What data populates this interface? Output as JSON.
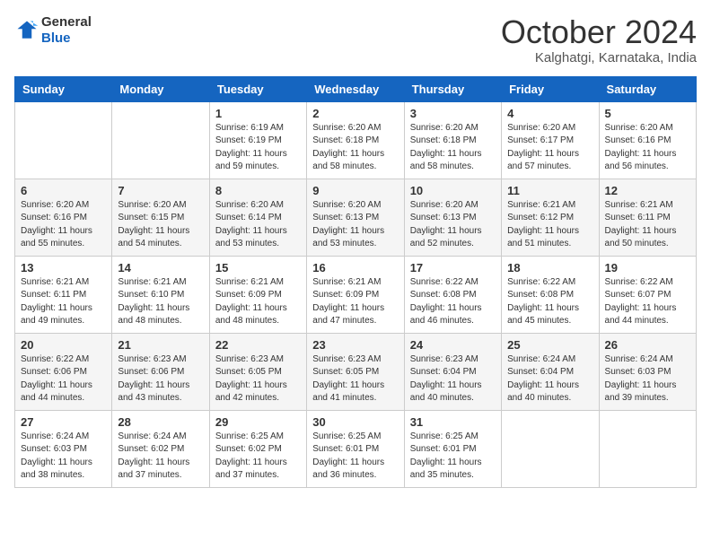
{
  "logo": {
    "general": "General",
    "blue": "Blue"
  },
  "title": "October 2024",
  "subtitle": "Kalghatgi, Karnataka, India",
  "days": [
    "Sunday",
    "Monday",
    "Tuesday",
    "Wednesday",
    "Thursday",
    "Friday",
    "Saturday"
  ],
  "weeks": [
    [
      {
        "day": "",
        "sunrise": "",
        "sunset": "",
        "daylight": ""
      },
      {
        "day": "",
        "sunrise": "",
        "sunset": "",
        "daylight": ""
      },
      {
        "day": "1",
        "sunrise": "Sunrise: 6:19 AM",
        "sunset": "Sunset: 6:19 PM",
        "daylight": "Daylight: 11 hours and 59 minutes."
      },
      {
        "day": "2",
        "sunrise": "Sunrise: 6:20 AM",
        "sunset": "Sunset: 6:18 PM",
        "daylight": "Daylight: 11 hours and 58 minutes."
      },
      {
        "day": "3",
        "sunrise": "Sunrise: 6:20 AM",
        "sunset": "Sunset: 6:18 PM",
        "daylight": "Daylight: 11 hours and 58 minutes."
      },
      {
        "day": "4",
        "sunrise": "Sunrise: 6:20 AM",
        "sunset": "Sunset: 6:17 PM",
        "daylight": "Daylight: 11 hours and 57 minutes."
      },
      {
        "day": "5",
        "sunrise": "Sunrise: 6:20 AM",
        "sunset": "Sunset: 6:16 PM",
        "daylight": "Daylight: 11 hours and 56 minutes."
      }
    ],
    [
      {
        "day": "6",
        "sunrise": "Sunrise: 6:20 AM",
        "sunset": "Sunset: 6:16 PM",
        "daylight": "Daylight: 11 hours and 55 minutes."
      },
      {
        "day": "7",
        "sunrise": "Sunrise: 6:20 AM",
        "sunset": "Sunset: 6:15 PM",
        "daylight": "Daylight: 11 hours and 54 minutes."
      },
      {
        "day": "8",
        "sunrise": "Sunrise: 6:20 AM",
        "sunset": "Sunset: 6:14 PM",
        "daylight": "Daylight: 11 hours and 53 minutes."
      },
      {
        "day": "9",
        "sunrise": "Sunrise: 6:20 AM",
        "sunset": "Sunset: 6:13 PM",
        "daylight": "Daylight: 11 hours and 53 minutes."
      },
      {
        "day": "10",
        "sunrise": "Sunrise: 6:20 AM",
        "sunset": "Sunset: 6:13 PM",
        "daylight": "Daylight: 11 hours and 52 minutes."
      },
      {
        "day": "11",
        "sunrise": "Sunrise: 6:21 AM",
        "sunset": "Sunset: 6:12 PM",
        "daylight": "Daylight: 11 hours and 51 minutes."
      },
      {
        "day": "12",
        "sunrise": "Sunrise: 6:21 AM",
        "sunset": "Sunset: 6:11 PM",
        "daylight": "Daylight: 11 hours and 50 minutes."
      }
    ],
    [
      {
        "day": "13",
        "sunrise": "Sunrise: 6:21 AM",
        "sunset": "Sunset: 6:11 PM",
        "daylight": "Daylight: 11 hours and 49 minutes."
      },
      {
        "day": "14",
        "sunrise": "Sunrise: 6:21 AM",
        "sunset": "Sunset: 6:10 PM",
        "daylight": "Daylight: 11 hours and 48 minutes."
      },
      {
        "day": "15",
        "sunrise": "Sunrise: 6:21 AM",
        "sunset": "Sunset: 6:09 PM",
        "daylight": "Daylight: 11 hours and 48 minutes."
      },
      {
        "day": "16",
        "sunrise": "Sunrise: 6:21 AM",
        "sunset": "Sunset: 6:09 PM",
        "daylight": "Daylight: 11 hours and 47 minutes."
      },
      {
        "day": "17",
        "sunrise": "Sunrise: 6:22 AM",
        "sunset": "Sunset: 6:08 PM",
        "daylight": "Daylight: 11 hours and 46 minutes."
      },
      {
        "day": "18",
        "sunrise": "Sunrise: 6:22 AM",
        "sunset": "Sunset: 6:08 PM",
        "daylight": "Daylight: 11 hours and 45 minutes."
      },
      {
        "day": "19",
        "sunrise": "Sunrise: 6:22 AM",
        "sunset": "Sunset: 6:07 PM",
        "daylight": "Daylight: 11 hours and 44 minutes."
      }
    ],
    [
      {
        "day": "20",
        "sunrise": "Sunrise: 6:22 AM",
        "sunset": "Sunset: 6:06 PM",
        "daylight": "Daylight: 11 hours and 44 minutes."
      },
      {
        "day": "21",
        "sunrise": "Sunrise: 6:23 AM",
        "sunset": "Sunset: 6:06 PM",
        "daylight": "Daylight: 11 hours and 43 minutes."
      },
      {
        "day": "22",
        "sunrise": "Sunrise: 6:23 AM",
        "sunset": "Sunset: 6:05 PM",
        "daylight": "Daylight: 11 hours and 42 minutes."
      },
      {
        "day": "23",
        "sunrise": "Sunrise: 6:23 AM",
        "sunset": "Sunset: 6:05 PM",
        "daylight": "Daylight: 11 hours and 41 minutes."
      },
      {
        "day": "24",
        "sunrise": "Sunrise: 6:23 AM",
        "sunset": "Sunset: 6:04 PM",
        "daylight": "Daylight: 11 hours and 40 minutes."
      },
      {
        "day": "25",
        "sunrise": "Sunrise: 6:24 AM",
        "sunset": "Sunset: 6:04 PM",
        "daylight": "Daylight: 11 hours and 40 minutes."
      },
      {
        "day": "26",
        "sunrise": "Sunrise: 6:24 AM",
        "sunset": "Sunset: 6:03 PM",
        "daylight": "Daylight: 11 hours and 39 minutes."
      }
    ],
    [
      {
        "day": "27",
        "sunrise": "Sunrise: 6:24 AM",
        "sunset": "Sunset: 6:03 PM",
        "daylight": "Daylight: 11 hours and 38 minutes."
      },
      {
        "day": "28",
        "sunrise": "Sunrise: 6:24 AM",
        "sunset": "Sunset: 6:02 PM",
        "daylight": "Daylight: 11 hours and 37 minutes."
      },
      {
        "day": "29",
        "sunrise": "Sunrise: 6:25 AM",
        "sunset": "Sunset: 6:02 PM",
        "daylight": "Daylight: 11 hours and 37 minutes."
      },
      {
        "day": "30",
        "sunrise": "Sunrise: 6:25 AM",
        "sunset": "Sunset: 6:01 PM",
        "daylight": "Daylight: 11 hours and 36 minutes."
      },
      {
        "day": "31",
        "sunrise": "Sunrise: 6:25 AM",
        "sunset": "Sunset: 6:01 PM",
        "daylight": "Daylight: 11 hours and 35 minutes."
      },
      {
        "day": "",
        "sunrise": "",
        "sunset": "",
        "daylight": ""
      },
      {
        "day": "",
        "sunrise": "",
        "sunset": "",
        "daylight": ""
      }
    ]
  ]
}
